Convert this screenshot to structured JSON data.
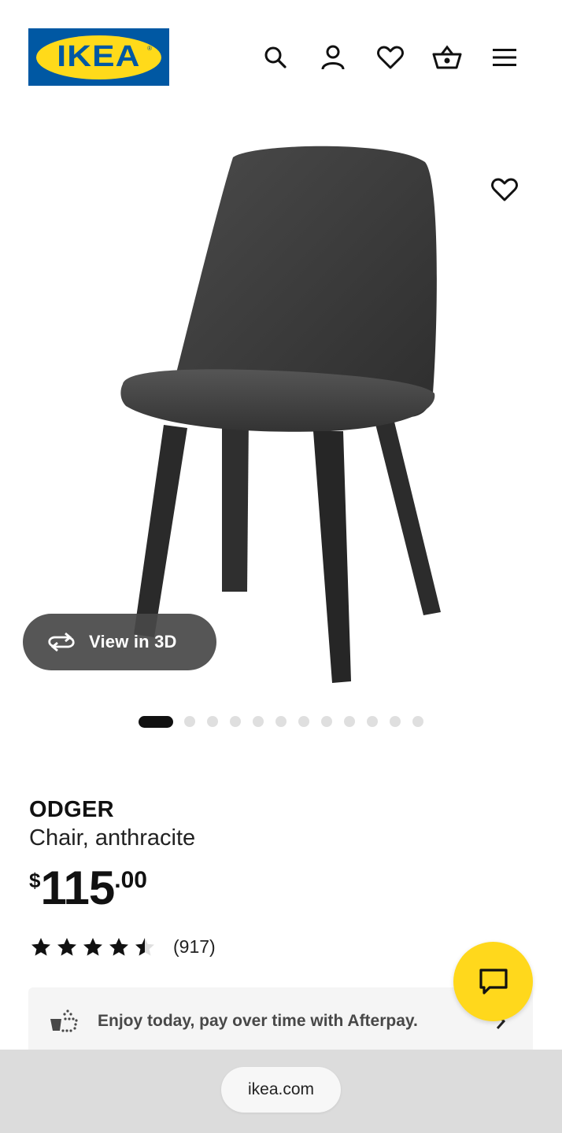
{
  "brand": {
    "logo_text": "IKEA",
    "logo_mark": "®",
    "colors": {
      "blue": "#0058a3",
      "yellow": "#ffda1a"
    }
  },
  "header": {
    "icons": [
      "search-icon",
      "account-icon",
      "heart-icon",
      "basket-icon",
      "menu-icon"
    ]
  },
  "gallery": {
    "view3d_label": "View in 3D",
    "image_count": 13,
    "active_index": 0
  },
  "product": {
    "name": "ODGER",
    "description": "Chair, anthracite",
    "price": {
      "currency": "$",
      "integer": "115",
      "decimal": ".00"
    },
    "rating": {
      "stars": 4.5,
      "count": "(917)"
    }
  },
  "afterpay": {
    "text": "Enjoy today, pay over time with Afterpay."
  },
  "chat": {
    "icon": "chat-icon",
    "color": "#ffd81c"
  },
  "browser": {
    "url": "ikea.com"
  }
}
